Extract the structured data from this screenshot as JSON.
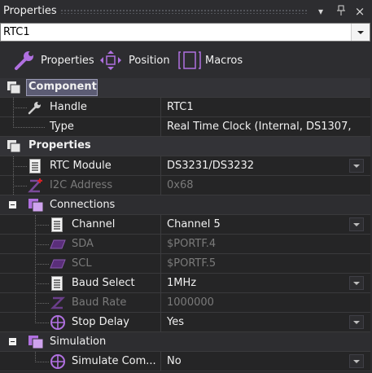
{
  "window": {
    "title": "Properties",
    "pin_glyph": "↓",
    "close_glyph": "×",
    "menu_glyph": "▾"
  },
  "selector": {
    "value": "RTC1"
  },
  "tabs": [
    {
      "label": "Properties",
      "icon": "wrench-icon"
    },
    {
      "label": "Position",
      "icon": "move-arrows-icon"
    },
    {
      "label": "Macros",
      "icon": "macros-icon"
    }
  ],
  "categories": {
    "component": "Component",
    "properties": "Properties",
    "connections": "Connections",
    "simulation": "Simulation"
  },
  "rows": {
    "handle": {
      "name": "Handle",
      "value": "RTC1"
    },
    "type": {
      "name": "Type",
      "value": "Real Time Clock (Internal, DS1307,..."
    },
    "rtc_module": {
      "name": "RTC Module",
      "value": "DS3231/DS3232"
    },
    "i2c_address": {
      "name": "I2C Address",
      "value": "0x68"
    },
    "channel": {
      "name": "Channel",
      "value": "Channel 5"
    },
    "sda": {
      "name": "SDA",
      "value": "$PORTF.4"
    },
    "scl": {
      "name": "SCL",
      "value": "$PORTF.5"
    },
    "baud_select": {
      "name": "Baud Select",
      "value": "1MHz"
    },
    "baud_rate": {
      "name": "Baud Rate",
      "value": "1000000"
    },
    "stop_delay": {
      "name": "Stop Delay",
      "value": "Yes"
    },
    "simulate_comms": {
      "name": "Simulate Com...",
      "value": "No"
    }
  },
  "colors": {
    "background": "#2d2d30",
    "grid_background": "#252526",
    "accent_purple": "#b070e0",
    "disabled_text": "#7a7a7a",
    "selection": "#5c5c74"
  }
}
